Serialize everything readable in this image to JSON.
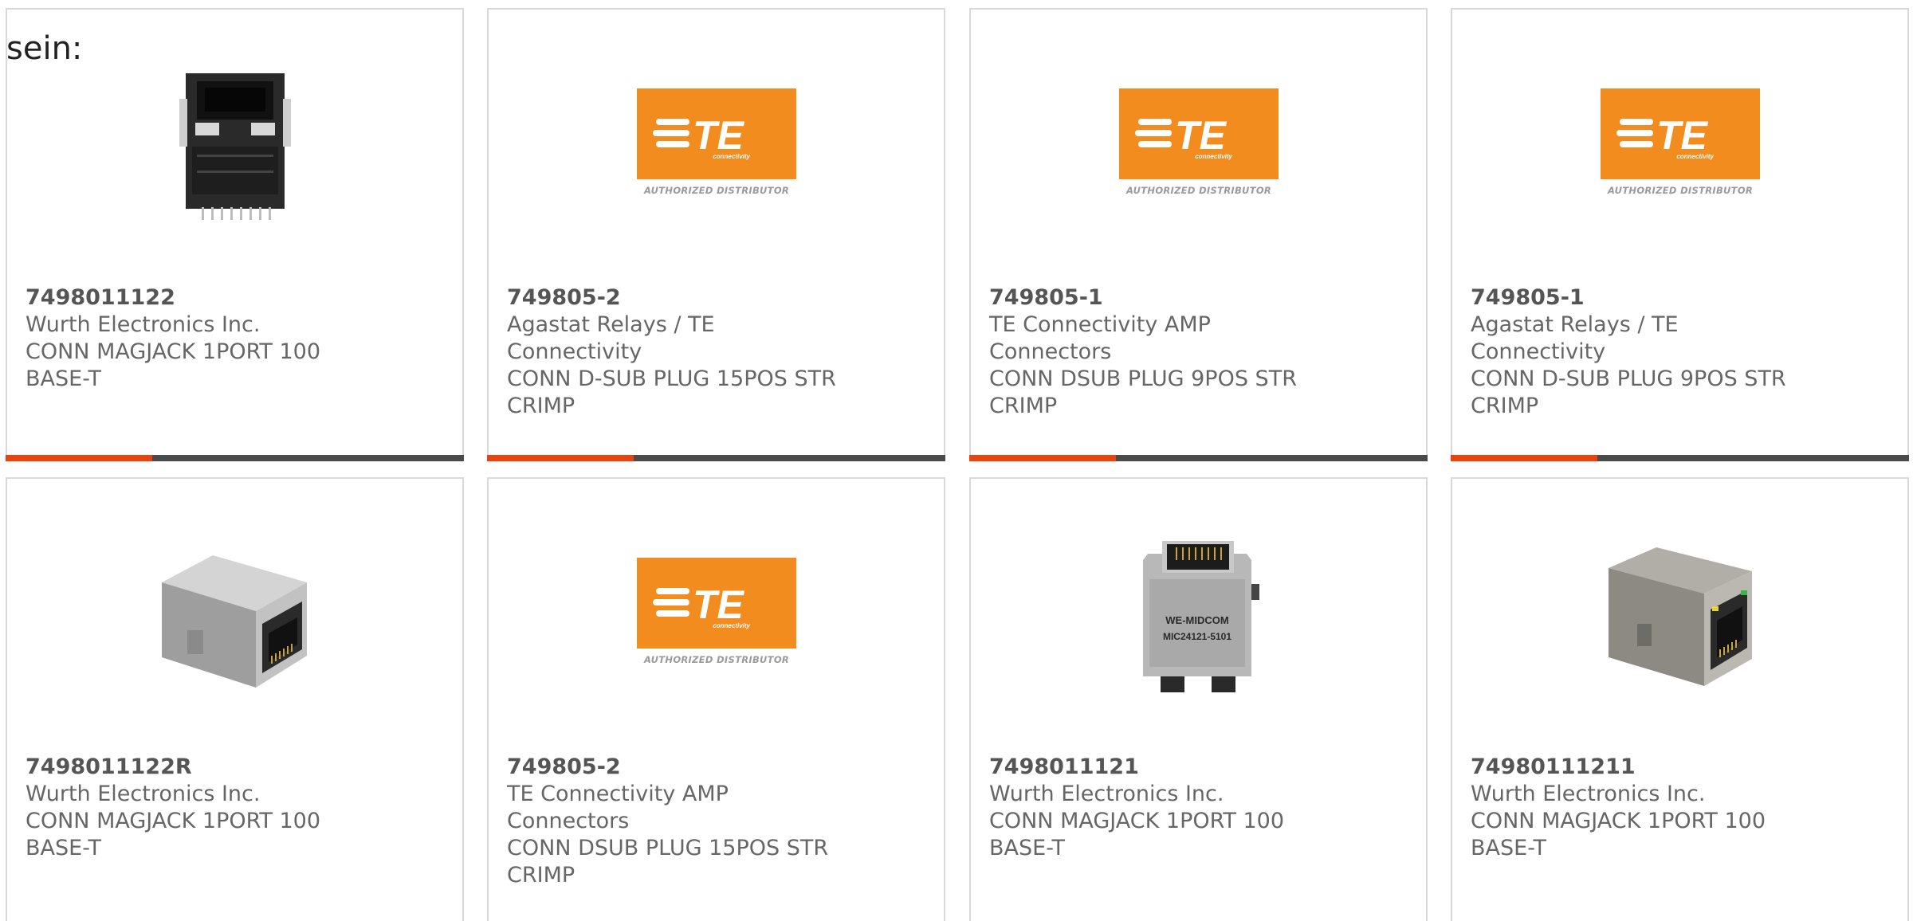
{
  "intro_text": "sein:",
  "colors": {
    "accent": "#e8420f",
    "bar": "#4a4a4a",
    "te_orange": "#f28c1e",
    "text": "#666666",
    "card_border": "#d9d9d9"
  },
  "te_logo": {
    "brand": "TE",
    "sub": "connectivity",
    "distributor": "AUTHORIZED DISTRIBUTOR"
  },
  "products": [
    {
      "part_number": "7498011122",
      "manufacturer": "Wurth Electronics Inc.",
      "description": "CONN MAGJACK 1PORT 100 BASE-T",
      "image": "rj45-jack-front-black"
    },
    {
      "part_number": "749805-2",
      "manufacturer": "Agastat Relays / TE Connectivity",
      "description": "CONN D-SUB PLUG 15POS STR CRIMP",
      "image": "te-logo"
    },
    {
      "part_number": "749805-1",
      "manufacturer": "TE Connectivity AMP Connectors",
      "description": "CONN DSUB PLUG 9POS STR CRIMP",
      "image": "te-logo"
    },
    {
      "part_number": "749805-1",
      "manufacturer": "Agastat Relays / TE Connectivity",
      "description": "CONN D-SUB PLUG 9POS STR CRIMP",
      "image": "te-logo"
    },
    {
      "part_number": "7498011122R",
      "manufacturer": "Wurth Electronics Inc.",
      "description": "CONN MAGJACK 1PORT 100 BASE-T",
      "image": "rj45-jack-angled"
    },
    {
      "part_number": "749805-2",
      "manufacturer": "TE Connectivity AMP Connectors",
      "description": "CONN DSUB PLUG 15POS STR CRIMP",
      "image": "te-logo"
    },
    {
      "part_number": "7498011121",
      "manufacturer": "Wurth Electronics Inc.",
      "description": "CONN MAGJACK 1PORT 100 BASE-T",
      "image": "rj45-jack-we-midcom",
      "image_label_1": "WE-MIDCOM",
      "image_label_2": "MIC24121-5101"
    },
    {
      "part_number": "74980111211",
      "manufacturer": "Wurth Electronics Inc.",
      "description": "CONN MAGJACK 1PORT 100 BASE-T",
      "image": "rj45-jack-angled-led"
    }
  ]
}
